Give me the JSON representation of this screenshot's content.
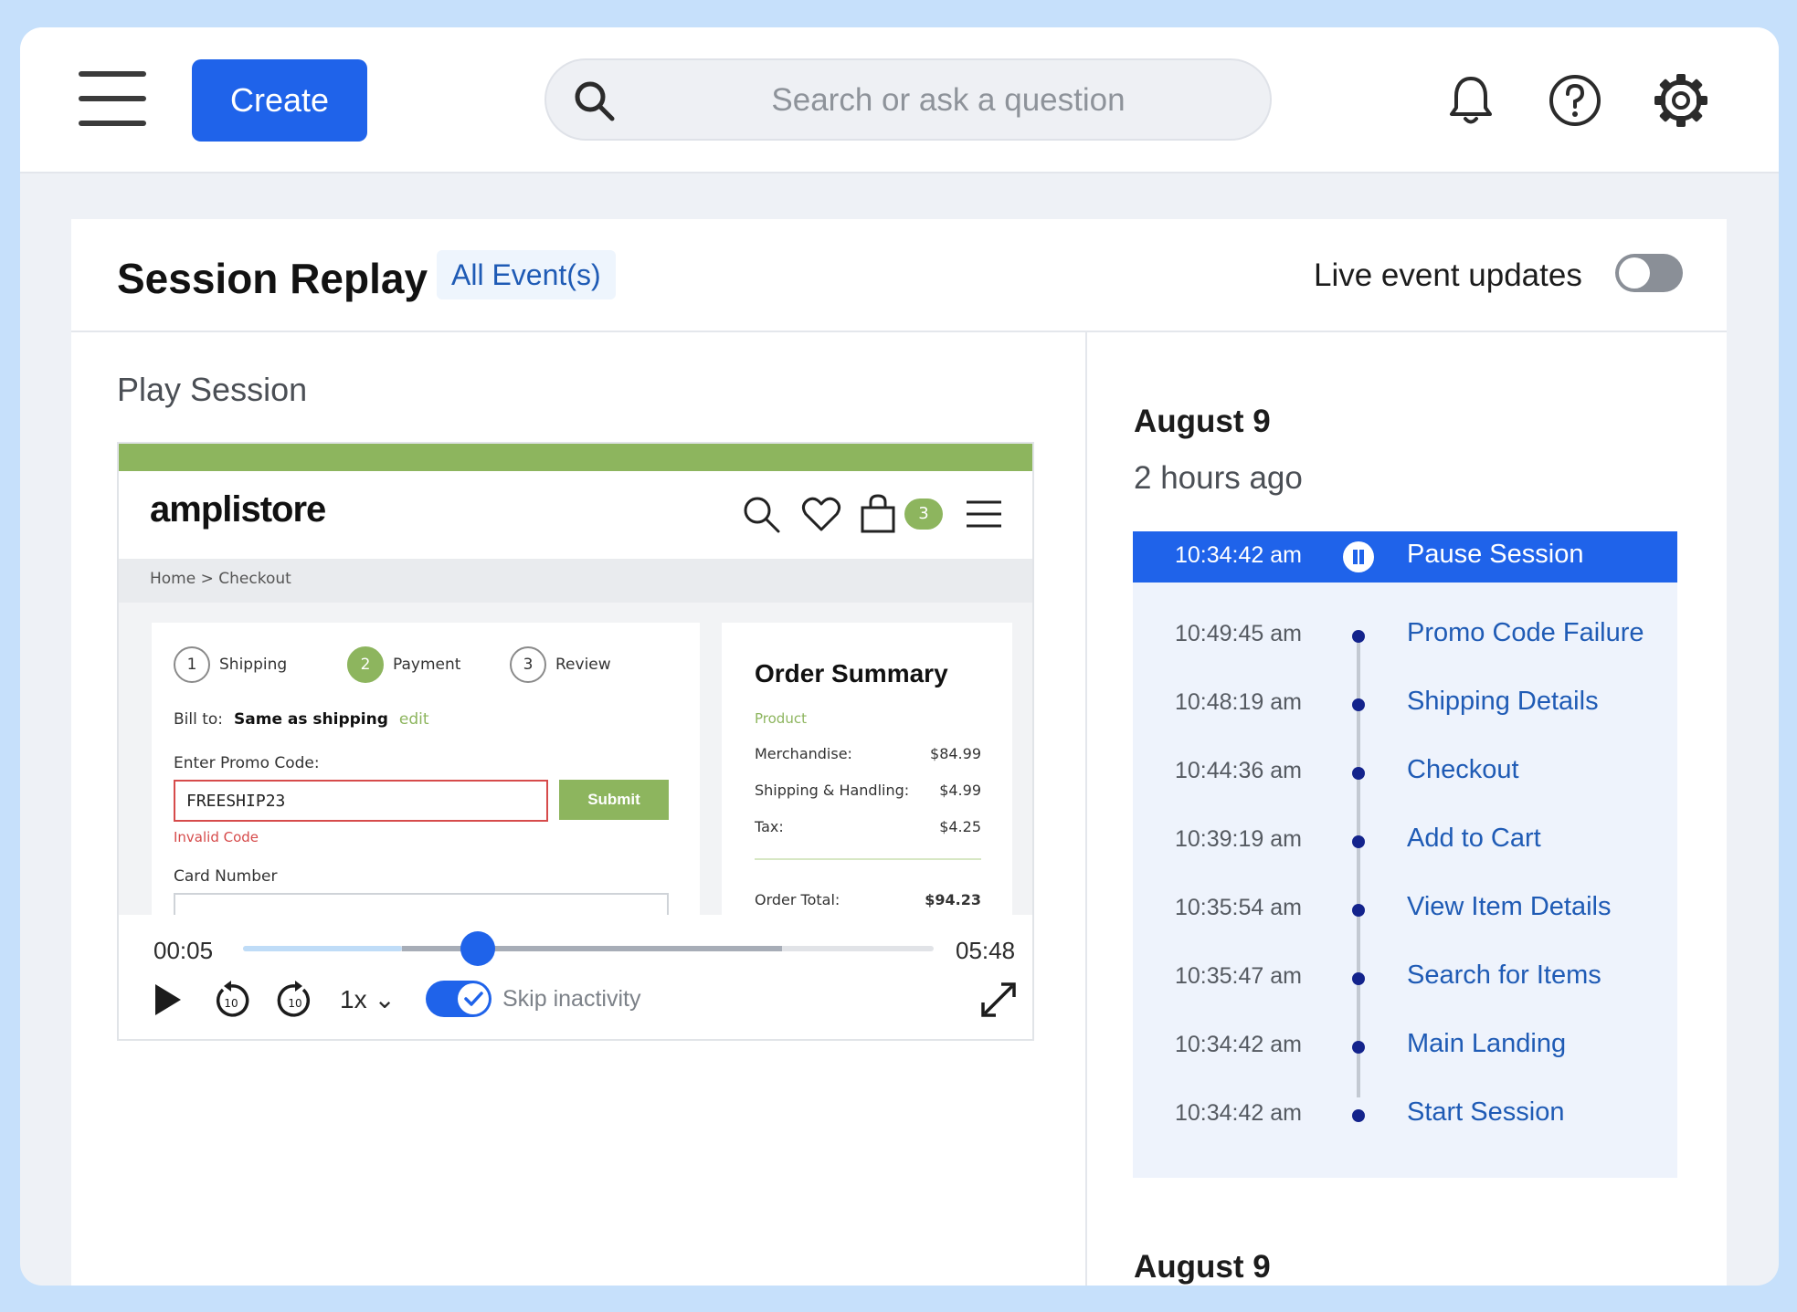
{
  "topbar": {
    "create_label": "Create",
    "search_placeholder": "Search or ask a question"
  },
  "header": {
    "title": "Session Replay",
    "events_tag": "All Event(s)",
    "live_label": "Live event updates",
    "live_enabled": false
  },
  "player": {
    "section_label": "Play Session",
    "store": {
      "brand": "amplistore",
      "cart_count": "3",
      "breadcrumb": "Home  >  Checkout",
      "steps": [
        {
          "num": "1",
          "label": "Shipping"
        },
        {
          "num": "2",
          "label": "Payment"
        },
        {
          "num": "3",
          "label": "Review"
        }
      ],
      "bill_to_label": "Bill to:",
      "bill_to_value": "Same as shipping",
      "edit_label": "edit",
      "promo_label": "Enter Promo Code:",
      "promo_value": "FREESHIP23",
      "submit_label": "Submit",
      "error_text": "Invalid Code",
      "card_label": "Card Number",
      "summary": {
        "title": "Order Summary",
        "subtitle": "Product",
        "rows": [
          {
            "label": "Merchandise:",
            "value": "$84.99"
          },
          {
            "label": "Shipping & Handling:",
            "value": "$4.99"
          },
          {
            "label": "Tax:",
            "value": "$4.25"
          }
        ],
        "total_label": "Order Total:",
        "total_value": "$94.23"
      }
    },
    "current_time": "00:05",
    "total_time": "05:48",
    "progress_fraction": 0.34,
    "buffer_fraction": 0.78,
    "played_fraction": 0.23,
    "speed": "1x ⌄",
    "skip_label": "Skip inactivity",
    "skip_enabled": true
  },
  "timeline": {
    "date": "August 9",
    "relative": "2 hours ago",
    "active": {
      "time": "10:34:42 am",
      "label": "Pause Session"
    },
    "events": [
      {
        "time": "10:49:45 am",
        "label": "Promo Code Failure"
      },
      {
        "time": "10:48:19 am",
        "label": "Shipping Details"
      },
      {
        "time": "10:44:36 am",
        "label": "Checkout"
      },
      {
        "time": "10:39:19 am",
        "label": "Add to Cart"
      },
      {
        "time": "10:35:54 am",
        "label": "View Item Details"
      },
      {
        "time": "10:35:47 am",
        "label": "Search for Items"
      },
      {
        "time": "10:34:42 am",
        "label": "Main Landing"
      },
      {
        "time": "10:34:42 am",
        "label": "Start Session"
      }
    ],
    "next_date": "August 9"
  },
  "colors": {
    "accent": "#1f63ea",
    "store_green": "#8db55e",
    "error": "#d64b4b"
  }
}
